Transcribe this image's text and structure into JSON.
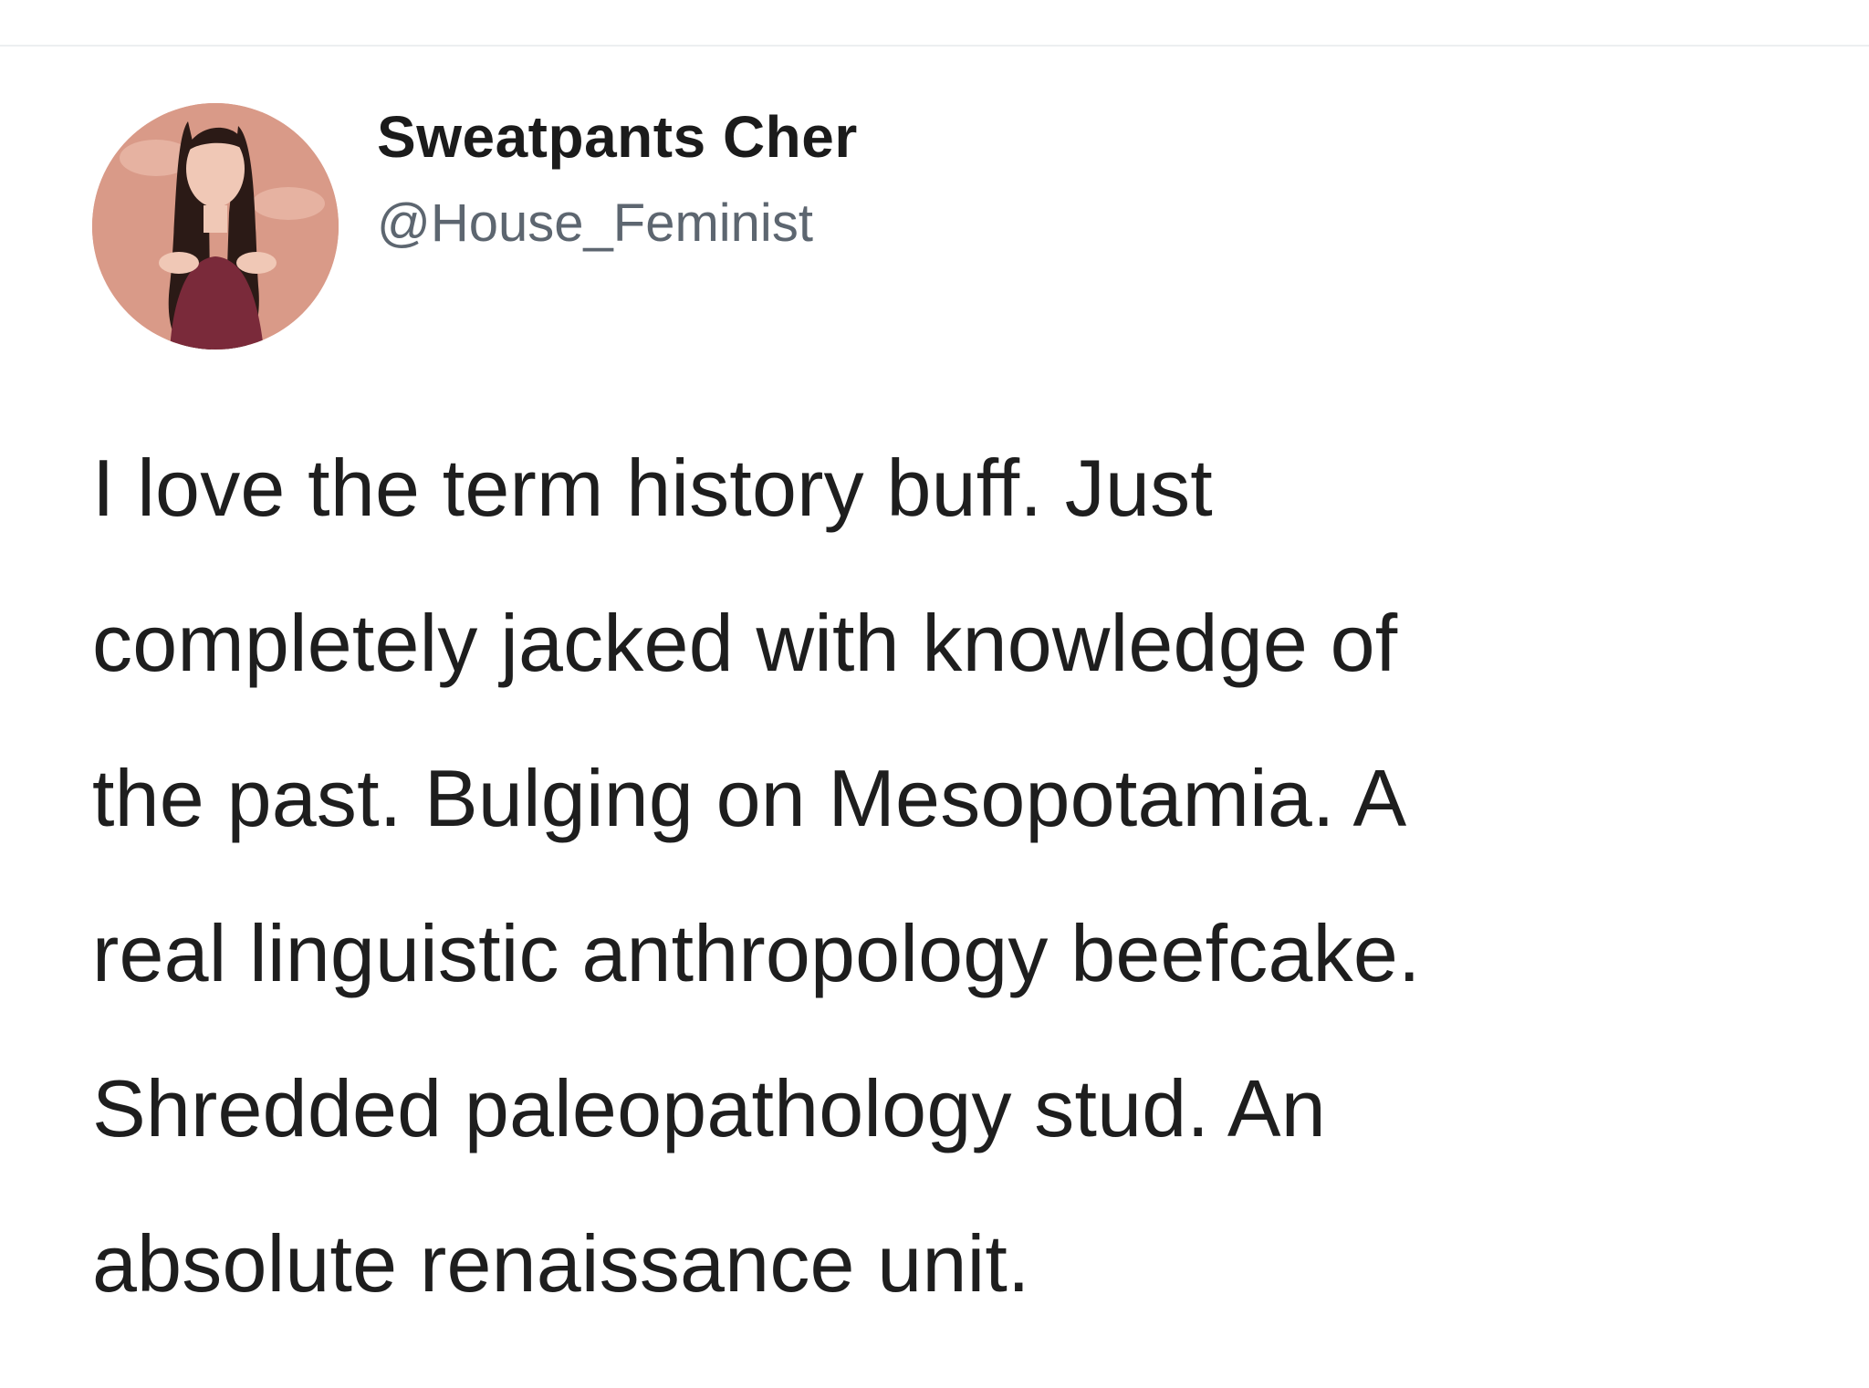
{
  "tweet": {
    "author": {
      "display_name": "Sweatpants Cher",
      "handle": "@House_Feminist",
      "avatar_icon": "profile-photo-icon"
    },
    "text_lines": [
      "I love the term history buff. Just",
      "completely jacked with knowledge of",
      "the past. Bulging on Mesopotamia. A",
      "real linguistic anthropology beefcake.",
      "Shredded paleopathology stud. An",
      "absolute renaissance unit."
    ]
  },
  "colors": {
    "background": "#ffffff",
    "name": "#1b1b1b",
    "handle": "#5d6670",
    "body_text": "#1e1e1e",
    "avatar_background": "#d99a88"
  }
}
